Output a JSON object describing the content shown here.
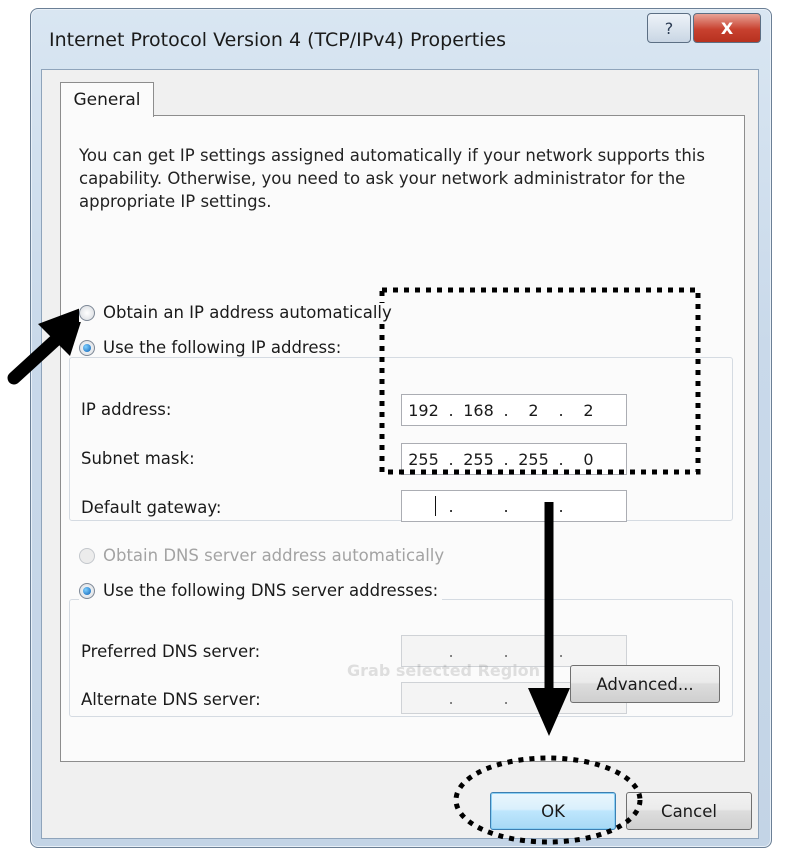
{
  "window": {
    "title": "Internet Protocol Version 4 (TCP/IPv4) Properties",
    "help_glyph": "?",
    "close_glyph": "X"
  },
  "tabs": [
    {
      "label": "General",
      "active": true
    }
  ],
  "intro_text": "You can get IP settings assigned automatically if your network supports this capability. Otherwise, you need to ask your network administrator for the appropriate IP settings.",
  "ip_section": {
    "auto_label": "Obtain an IP address automatically",
    "manual_label": "Use the following IP address:",
    "selected": "manual",
    "fields": [
      {
        "label": "IP address:",
        "octets": [
          "192",
          "168",
          "2",
          "2"
        ]
      },
      {
        "label": "Subnet mask:",
        "octets": [
          "255",
          "255",
          "255",
          "0"
        ]
      },
      {
        "label": "Default gateway:",
        "octets": [
          "",
          "",
          "",
          ""
        ]
      }
    ]
  },
  "dns_section": {
    "auto_label": "Obtain DNS server address automatically",
    "manual_label": "Use the following DNS server addresses:",
    "selected": "manual",
    "fields": [
      {
        "label": "Preferred DNS server:",
        "octets": [
          "",
          "",
          "",
          ""
        ]
      },
      {
        "label": "Alternate DNS server:",
        "octets": [
          "",
          "",
          "",
          ""
        ]
      }
    ]
  },
  "watermark": "Grab selected Region",
  "buttons": {
    "advanced": "Advanced...",
    "ok": "OK",
    "cancel": "Cancel"
  },
  "colors": {
    "annotation": "#000000",
    "ok_accent": "#3c7fb1",
    "close_button": "#c8412f"
  },
  "annotations": [
    "arrow-pointing-to-use-following-ip",
    "dotted-box-around-ip-fields",
    "arrow-down-to-ok",
    "dotted-circle-around-ok"
  ]
}
